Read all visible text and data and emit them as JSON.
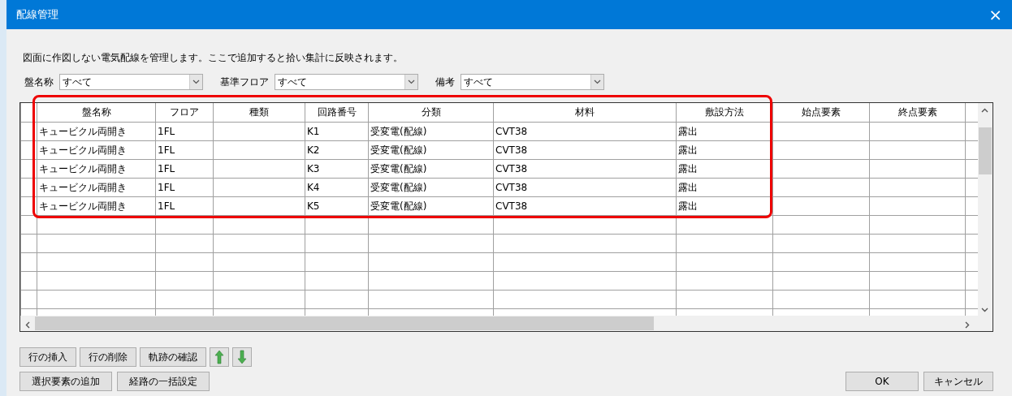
{
  "window": {
    "title": "配線管理",
    "close": "×"
  },
  "description": "図面に作図しない電気配線を管理します。ここで追加すると拾い集計に反映されます。",
  "filters": [
    {
      "label": "盤名称",
      "value": "すべて"
    },
    {
      "label": "基準フロア",
      "value": "すべて"
    },
    {
      "label": "備考",
      "value": "すべて"
    }
  ],
  "table": {
    "columns": [
      "盤名称",
      "フロア",
      "種類",
      "回路番号",
      "分類",
      "材料",
      "敷設方法",
      "始点要素",
      "終点要素"
    ],
    "rows": [
      [
        "キュービクル両開き",
        "1FL",
        "",
        "K1",
        "受変電(配線)",
        "CVT38",
        "露出",
        "",
        ""
      ],
      [
        "キュービクル両開き",
        "1FL",
        "",
        "K2",
        "受変電(配線)",
        "CVT38",
        "露出",
        "",
        ""
      ],
      [
        "キュービクル両開き",
        "1FL",
        "",
        "K3",
        "受変電(配線)",
        "CVT38",
        "露出",
        "",
        ""
      ],
      [
        "キュービクル両開き",
        "1FL",
        "",
        "K4",
        "受変電(配線)",
        "CVT38",
        "露出",
        "",
        ""
      ],
      [
        "キュービクル両開き",
        "1FL",
        "",
        "K5",
        "受変電(配線)",
        "CVT38",
        "露出",
        "",
        ""
      ]
    ]
  },
  "row_buttons": [
    {
      "kind": "text",
      "label": "行の挿入"
    },
    {
      "kind": "text",
      "label": "行の削除"
    },
    {
      "kind": "text",
      "label": "軌跡の確認"
    },
    {
      "kind": "up"
    },
    {
      "kind": "down"
    }
  ],
  "route_buttons": [
    "選択要素の追加",
    "経路の一括設定"
  ],
  "dialog_buttons": [
    "OK",
    "キャンセル"
  ]
}
